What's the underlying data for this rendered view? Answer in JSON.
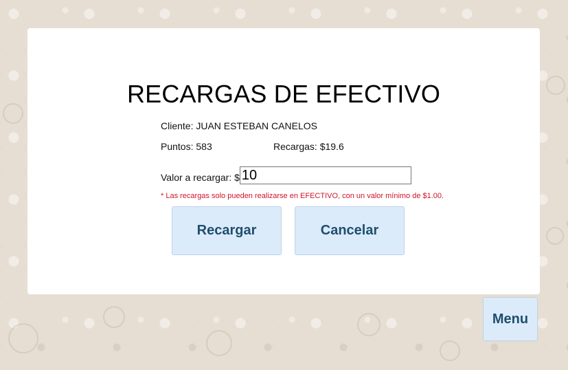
{
  "title": "RECARGAS DE EFECTIVO",
  "client_line": "Cliente: JUAN ESTEBAN CANELOS",
  "points_line": "Puntos: 583",
  "recharges_line": "Recargas: $19.6",
  "amount_label": "Valor a recargar: $",
  "amount_value": "10",
  "note": "* Las recargas solo pueden realizarse en EFECTIVO, con un valor mínimo de $1.00.",
  "buttons": {
    "recharge": "Recargar",
    "cancel": "Cancelar",
    "menu": "Menu"
  },
  "colors": {
    "background": "#e6ded2",
    "button_bg": "#dcebfa",
    "button_text": "#1f4e6e",
    "note_text": "#d0142a"
  }
}
